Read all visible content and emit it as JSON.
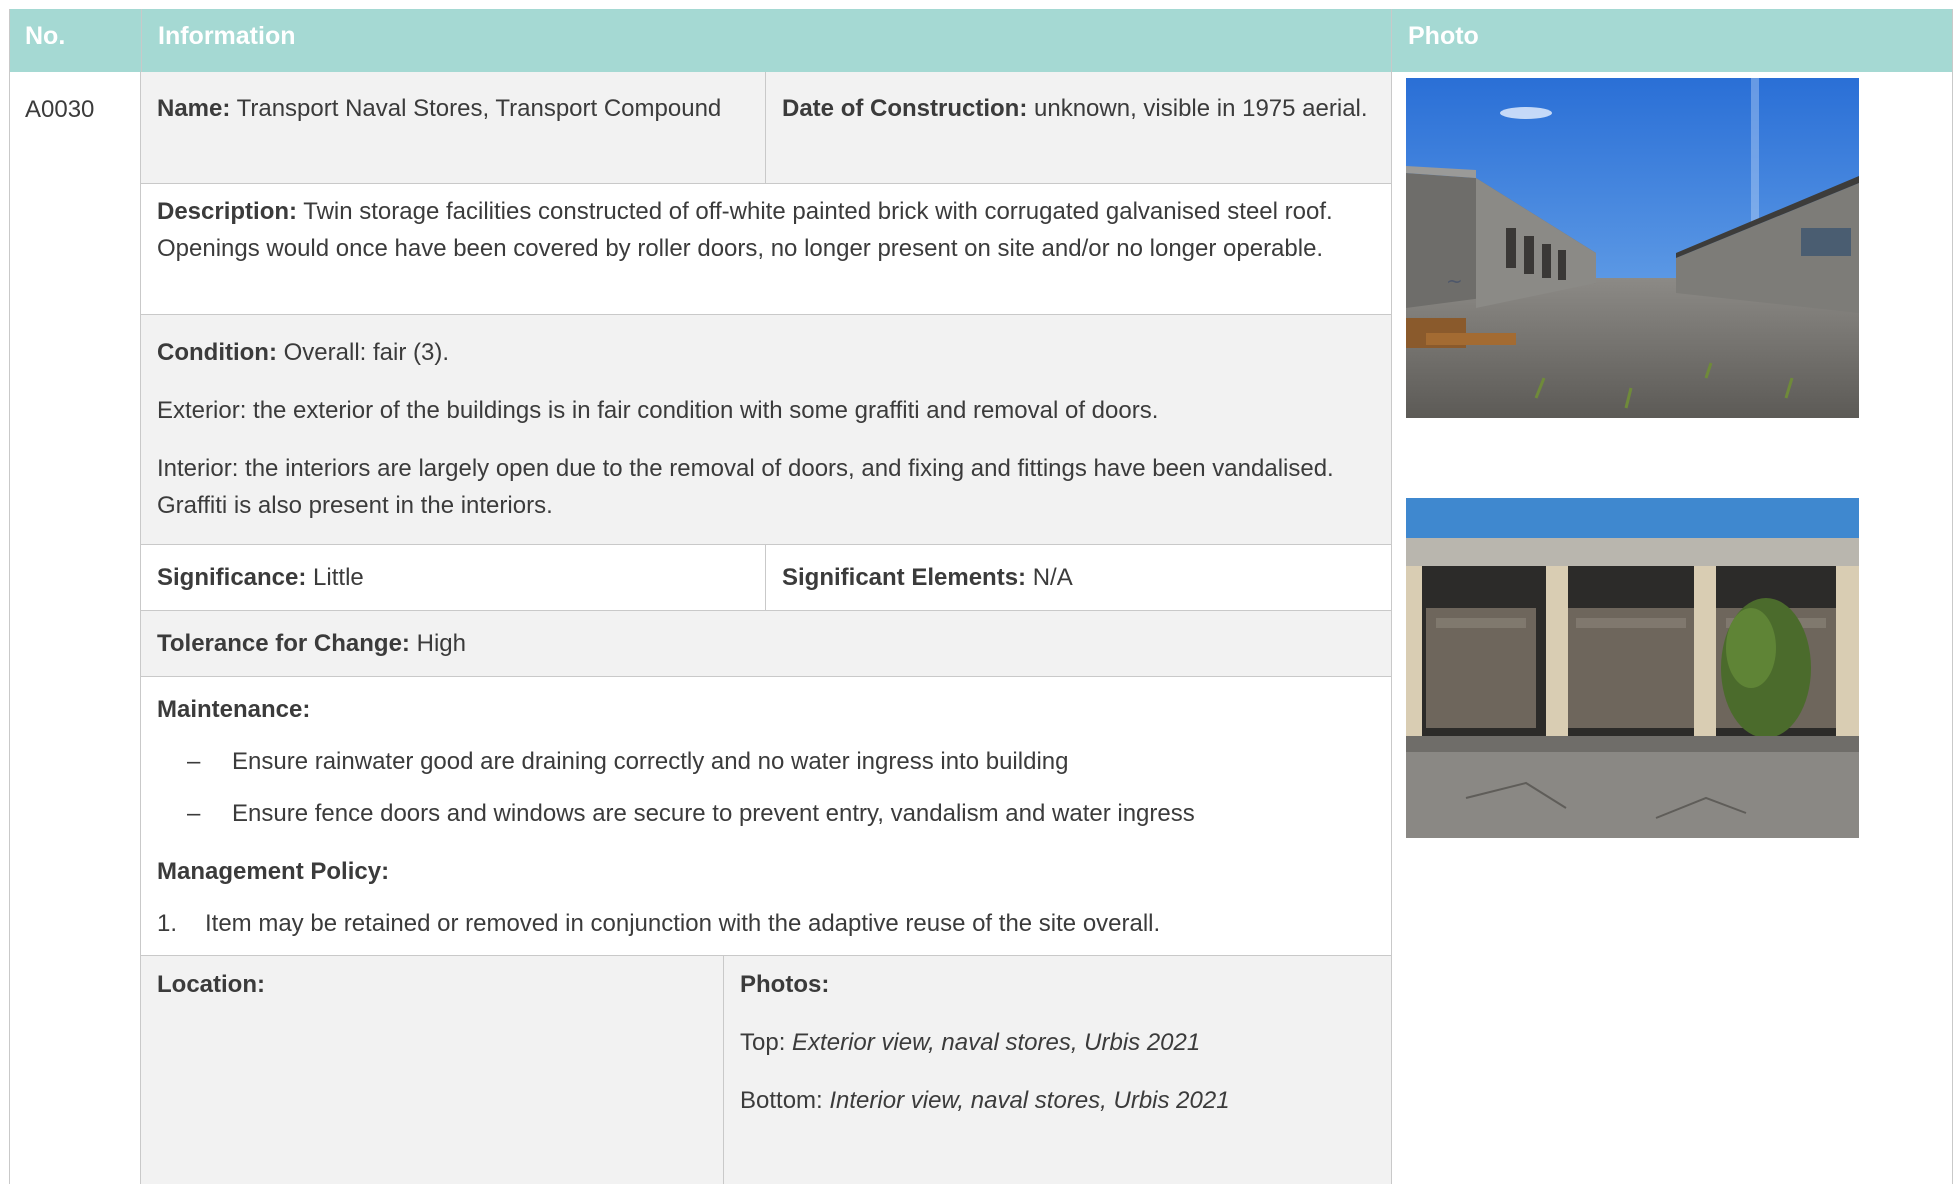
{
  "header": {
    "no": "No.",
    "information": "Information",
    "photo": "Photo"
  },
  "item_no": "A0030",
  "name": {
    "label": "Name:",
    "value": "Transport Naval Stores, Transport Compound"
  },
  "date_of_construction": {
    "label": "Date of Construction:",
    "value": "unknown, visible in 1975 aerial."
  },
  "description": {
    "label": "Description:",
    "value": "Twin storage facilities constructed of off-white painted brick with corrugated galvanised steel roof. Openings would once have been covered by roller doors, no longer present on site and/or no longer operable."
  },
  "condition": {
    "label": "Condition:",
    "overall": "Overall: fair (3).",
    "exterior": "Exterior: the exterior of the buildings is in fair condition with some graffiti and removal of doors.",
    "interior": "Interior: the interiors are largely open due to the removal of doors, and fixing and fittings have been vandalised. Graffiti is also present in the interiors."
  },
  "significance": {
    "label": "Significance:",
    "value": "Little"
  },
  "significant_elements": {
    "label": "Significant Elements:",
    "value": "N/A"
  },
  "tolerance": {
    "label": "Tolerance for Change:",
    "value": "High"
  },
  "maintenance": {
    "label": "Maintenance:",
    "items": [
      "Ensure rainwater good are draining correctly and no water ingress into building",
      "Ensure fence doors and windows are secure to prevent entry, vandalism and water ingress"
    ]
  },
  "management_policy": {
    "label": "Management Policy:",
    "items": [
      {
        "number": "1.",
        "text": "Item may be retained or removed in conjunction with the adaptive reuse of the site overall."
      }
    ]
  },
  "location": {
    "label": "Location:"
  },
  "photos": {
    "label": "Photos:",
    "top_prefix": "Top:",
    "top_caption": "Exterior view, naval stores, Urbis 2021",
    "bottom_prefix": "Bottom:",
    "bottom_caption": "Interior view, naval stores, Urbis 2021"
  },
  "dash_symbol": "–",
  "colors": {
    "header_bg": "#a5d9d3",
    "header_text": "#ffffff",
    "shade": "#f2f2f2",
    "border": "#c9c9c9",
    "text": "#3b3b3b"
  }
}
